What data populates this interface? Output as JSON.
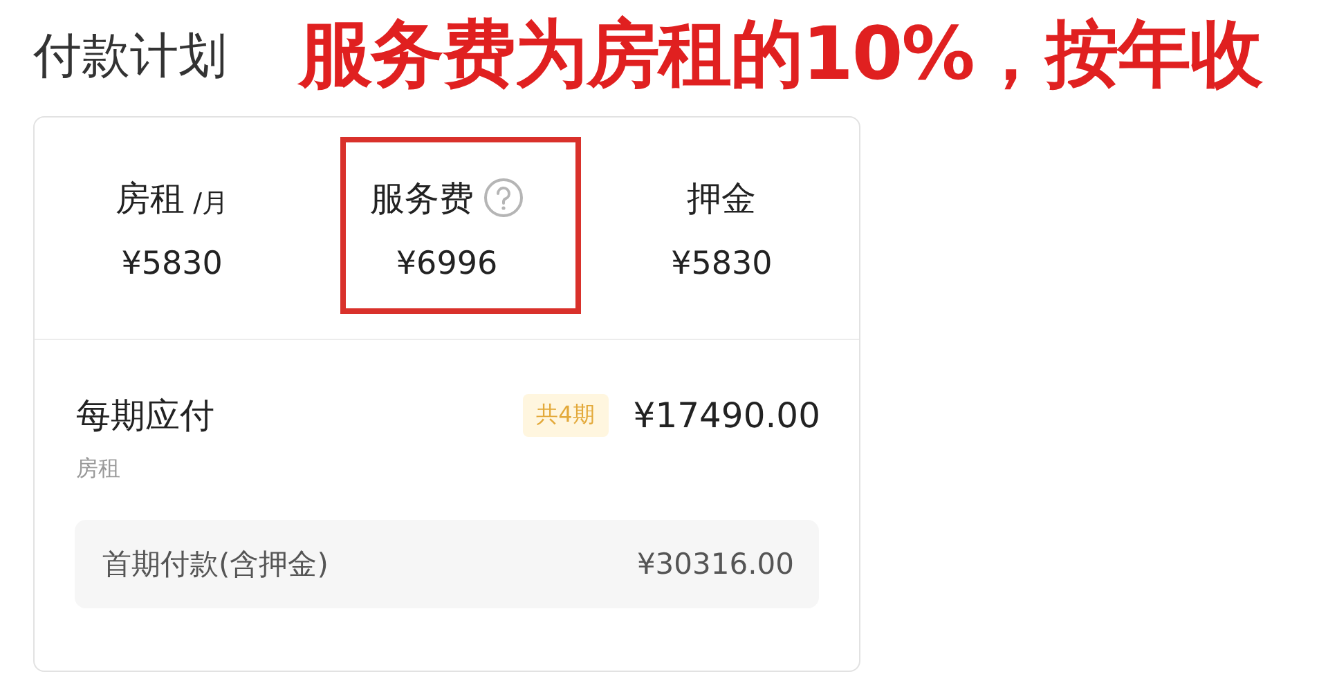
{
  "title": "付款计划",
  "annotation": "服务费为房租的10%，按年收",
  "fees": [
    {
      "label": "房租",
      "unit": "/月",
      "help": false,
      "highlighted": false,
      "amount": "¥5830"
    },
    {
      "label": "服务费",
      "help": true,
      "highlighted": true,
      "amount": "¥6996"
    },
    {
      "label": "押金",
      "help": false,
      "highlighted": false,
      "amount": "¥5830"
    }
  ],
  "per_period": {
    "label": "每期应付",
    "sub": "房租",
    "badge": "共4期",
    "amount": "¥17490.00"
  },
  "first_payment": {
    "label": "首期付款(含押金)",
    "amount": "¥30316.00"
  }
}
